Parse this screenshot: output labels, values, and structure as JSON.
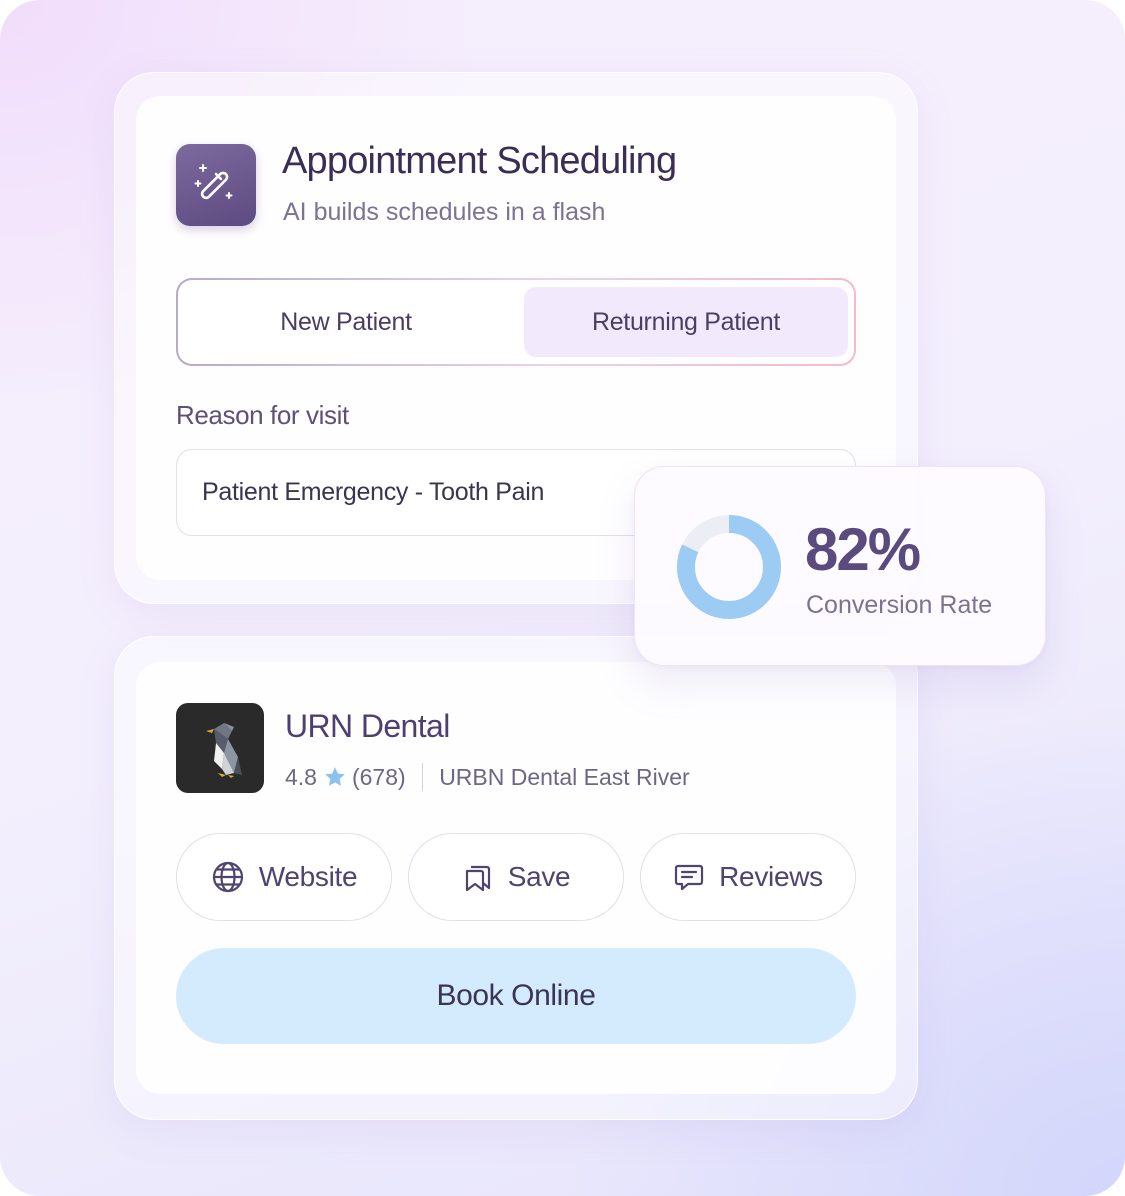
{
  "scheduling": {
    "title": "Appointment Scheduling",
    "subtitle": "AI builds schedules in a flash",
    "icon": "magic-wand-icon",
    "toggle": {
      "options": [
        {
          "label": "New Patient",
          "selected": false
        },
        {
          "label": "Returning Patient",
          "selected": true
        }
      ]
    },
    "reason_label": "Reason for visit",
    "reason_value": "Patient Emergency - Tooth Pain"
  },
  "conversion": {
    "percent_label": "82%",
    "label": "Conversion Rate",
    "value": 0.82,
    "color": "#9ccbf3"
  },
  "business": {
    "name": "URN Dental",
    "rating": "4.8",
    "reviews_count": "(678)",
    "location": "URBN Dental East River",
    "logo_icon": "penguin-logo",
    "actions": {
      "website": "Website",
      "save": "Save",
      "reviews": "Reviews"
    },
    "book_label": "Book Online",
    "accent_color": "#d4eafd"
  }
}
